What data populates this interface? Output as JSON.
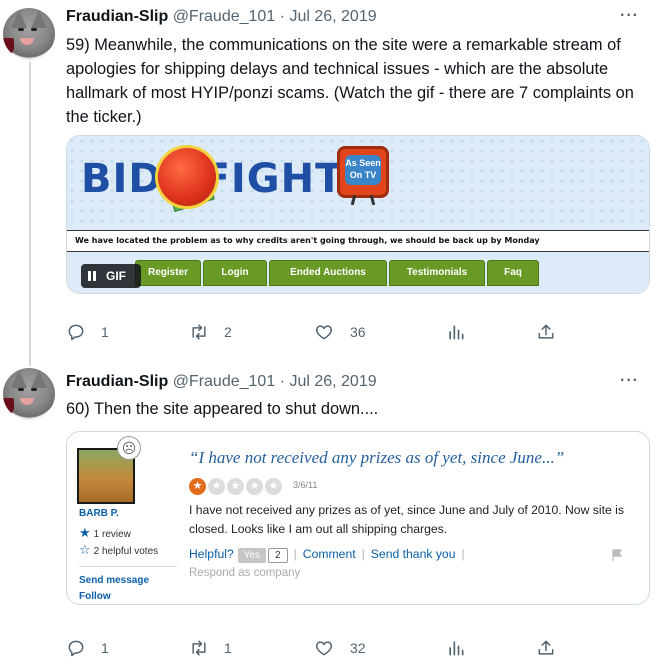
{
  "tweets": [
    {
      "author_name": "Fraudian-Slip",
      "handle_date": "@Fraude_101 · Jul 26, 2019",
      "more": "···",
      "text": "59) Meanwhile, the communications on the site were a remarkable stream of apologies for shipping delays and technical issues - which are the absolute hallmark of most HYIP/ponzi scams. (Watch the gif - there are 7 complaints on the ticker.)",
      "media": {
        "logo_left": "BID",
        "logo_right": "FIGHT",
        "tv_text_1": "As Seen",
        "tv_text_2": "On TV",
        "notice": "We have located the problem as to why credits aren't going through, we should be back up by Monday",
        "nav": [
          "Register",
          "Login",
          "Ended Auctions",
          "Testimonials",
          "Faq"
        ],
        "gif_label": "GIF"
      },
      "stats": {
        "replies": "1",
        "retweets": "2",
        "likes": "36"
      }
    },
    {
      "author_name": "Fraudian-Slip",
      "handle_date": "@Fraude_101 · Jul 26, 2019",
      "more": "···",
      "text": "60) Then the site appeared to shut down....",
      "media": {
        "reviewer": "BARB P.",
        "review_count": "1 review",
        "helpful_votes": "2 helpful votes",
        "send_message": "Send message",
        "follow": "Follow",
        "quote": "“I have not received any prizes as of yet, since June...”",
        "rating": 1,
        "rating_max": 5,
        "date": "3/6/11",
        "body": "I have not received any prizes as of yet, since June and July of 2010. Now site is closed. Looks like I am out all shipping charges.",
        "helpful": "Helpful?",
        "yes": "Yes",
        "yes_count": "2",
        "comment": "Comment",
        "send_thanks": "Send thank you",
        "respond": "Respond as company"
      },
      "stats": {
        "replies": "1",
        "retweets": "1",
        "likes": "32"
      }
    }
  ],
  "colors": {
    "brand_blue": "#0b5fa8",
    "twitter_gray": "#536471",
    "nav_green": "#6a9a26"
  },
  "icons": [
    "reply-icon",
    "retweet-icon",
    "like-icon",
    "analytics-icon",
    "share-icon"
  ]
}
